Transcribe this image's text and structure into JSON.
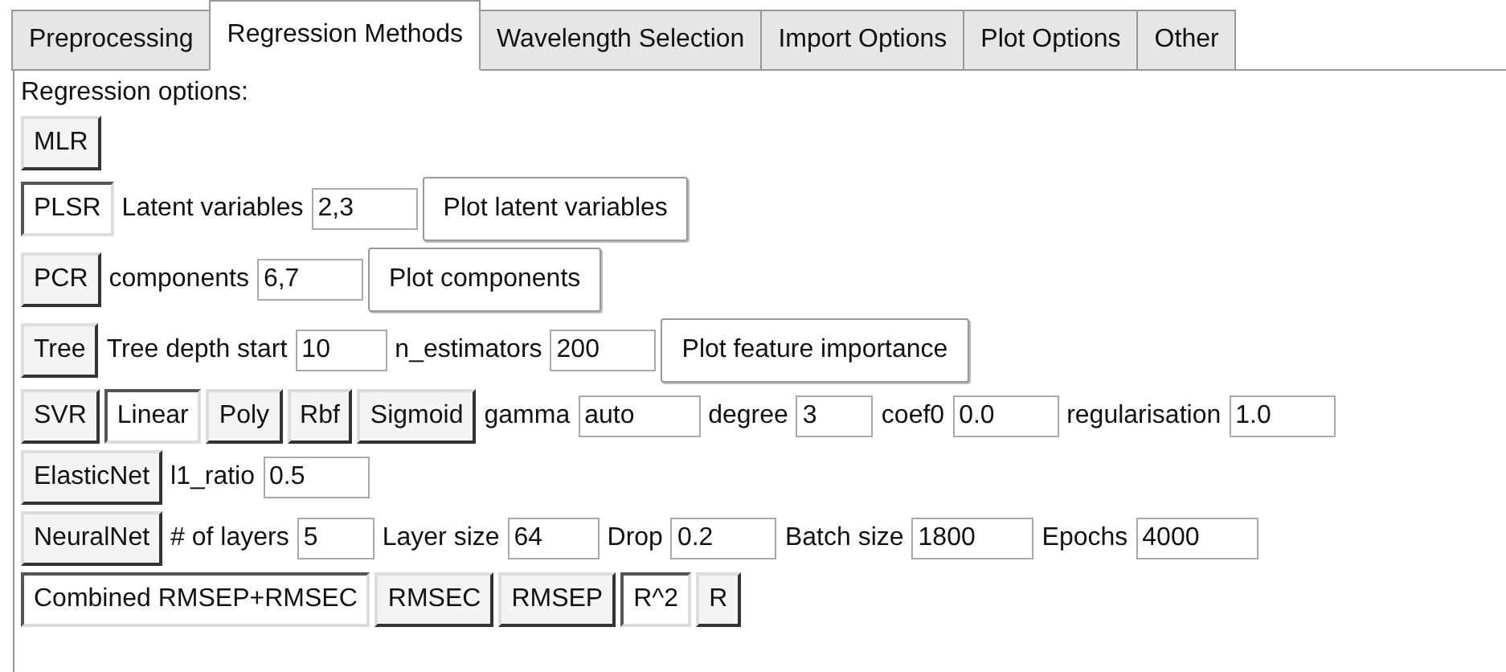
{
  "tabs": [
    {
      "label": "Preprocessing",
      "selected": false
    },
    {
      "label": "Regression Methods",
      "selected": true
    },
    {
      "label": "Wavelength Selection",
      "selected": false
    },
    {
      "label": "Import Options",
      "selected": false
    },
    {
      "label": "Plot Options",
      "selected": false
    },
    {
      "label": "Other",
      "selected": false
    }
  ],
  "heading": "Regression options:",
  "rows": [
    {
      "items": [
        {
          "kind": "toggle",
          "label": "MLR",
          "selected": false
        }
      ]
    },
    {
      "items": [
        {
          "kind": "toggle",
          "label": "PLSR",
          "selected": true
        },
        {
          "kind": "label",
          "text": "Latent variables"
        },
        {
          "kind": "field",
          "value": "2,3"
        },
        {
          "kind": "button",
          "label": "Plot latent variables"
        }
      ]
    },
    {
      "items": [
        {
          "kind": "toggle",
          "label": "PCR",
          "selected": false
        },
        {
          "kind": "label",
          "text": "components"
        },
        {
          "kind": "field",
          "value": "6,7"
        },
        {
          "kind": "button",
          "label": "Plot components"
        }
      ]
    },
    {
      "items": [
        {
          "kind": "toggle",
          "label": "Tree",
          "selected": false
        },
        {
          "kind": "label",
          "text": "Tree depth start"
        },
        {
          "kind": "field",
          "value": "10"
        },
        {
          "kind": "label",
          "text": "n_estimators"
        },
        {
          "kind": "field",
          "value": "200"
        },
        {
          "kind": "button",
          "label": "Plot feature importance"
        }
      ]
    },
    {
      "items": [
        {
          "kind": "toggle",
          "label": "SVR",
          "selected": false
        },
        {
          "kind": "toggle",
          "label": "Linear",
          "selected": true
        },
        {
          "kind": "toggle",
          "label": "Poly",
          "selected": false
        },
        {
          "kind": "toggle",
          "label": "Rbf",
          "selected": false
        },
        {
          "kind": "toggle",
          "label": "Sigmoid",
          "selected": false
        },
        {
          "kind": "label",
          "text": "gamma"
        },
        {
          "kind": "field",
          "value": "auto"
        },
        {
          "kind": "label",
          "text": "degree"
        },
        {
          "kind": "field",
          "value": "3"
        },
        {
          "kind": "label",
          "text": "coef0"
        },
        {
          "kind": "field",
          "value": "0.0"
        },
        {
          "kind": "label",
          "text": "regularisation"
        },
        {
          "kind": "field",
          "value": "1.0"
        }
      ]
    },
    {
      "items": [
        {
          "kind": "toggle",
          "label": "ElasticNet",
          "selected": false
        },
        {
          "kind": "label",
          "text": "l1_ratio"
        },
        {
          "kind": "field",
          "value": "0.5"
        }
      ]
    },
    {
      "items": [
        {
          "kind": "toggle",
          "label": "NeuralNet",
          "selected": false
        },
        {
          "kind": "label",
          "text": "# of layers"
        },
        {
          "kind": "field",
          "value": "5"
        },
        {
          "kind": "label",
          "text": "Layer size"
        },
        {
          "kind": "field",
          "value": "64"
        },
        {
          "kind": "label",
          "text": "Drop"
        },
        {
          "kind": "field",
          "value": "0.2"
        },
        {
          "kind": "label",
          "text": "Batch size"
        },
        {
          "kind": "field",
          "value": "1800"
        },
        {
          "kind": "label",
          "text": "Epochs"
        },
        {
          "kind": "field",
          "value": "4000"
        }
      ]
    },
    {
      "items": [
        {
          "kind": "toggle",
          "label": "Combined RMSEP+RMSEC",
          "selected": true
        },
        {
          "kind": "toggle",
          "label": "RMSEC",
          "selected": false
        },
        {
          "kind": "toggle",
          "label": "RMSEP",
          "selected": false
        },
        {
          "kind": "toggle",
          "label": "R^2",
          "selected": true
        },
        {
          "kind": "toggle",
          "label": "R",
          "selected": false
        }
      ]
    }
  ]
}
